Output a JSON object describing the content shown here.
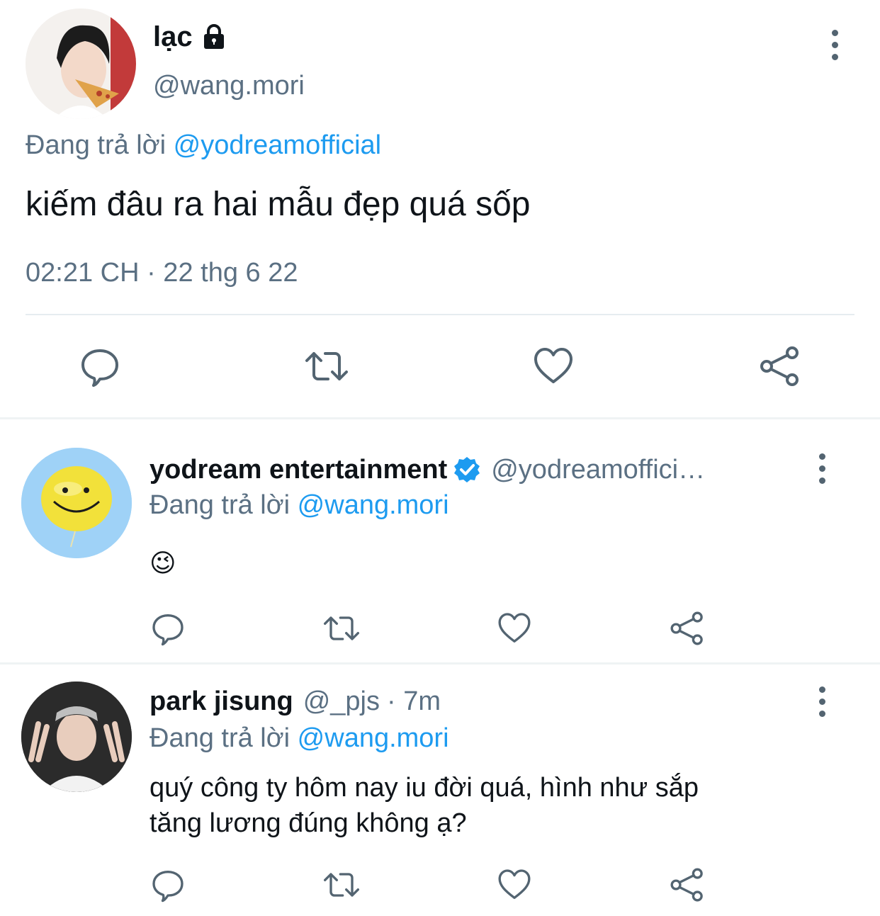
{
  "main_tweet": {
    "display_name": "lạc",
    "handle": "@wang.mori",
    "replying_prefix": "Đang trả lời",
    "replying_to": "@yodreamofficial",
    "text": "kiếm đâu ra hai mẫu đẹp quá sốp",
    "timestamp": "02:21 CH · 22 thg 6 22",
    "locked_icon": "lock-icon",
    "actions": [
      "reply-icon",
      "retweet-icon",
      "like-icon",
      "share-icon"
    ]
  },
  "replies": [
    {
      "display_name": "yodream entertainment",
      "verified_icon": "verified-badge-icon",
      "handle": "@yodreamoffici…",
      "replying_prefix": "Đang trả lời",
      "replying_to": "@wang.mori",
      "text": "😉"
    },
    {
      "display_name": "park jisung",
      "handle": "@_pjs",
      "time": "· 7m",
      "replying_prefix": "Đang trả lời",
      "replying_to": "@wang.mori",
      "text_line1": "quý công ty hôm nay iu đời quá, hình như sắp",
      "text_line2": "tăng lương đúng không ạ?"
    }
  ],
  "colors": {
    "accent": "#1d9bf0",
    "muted": "#5b7083",
    "icon": "#536471",
    "divider": "#eff3f4"
  }
}
